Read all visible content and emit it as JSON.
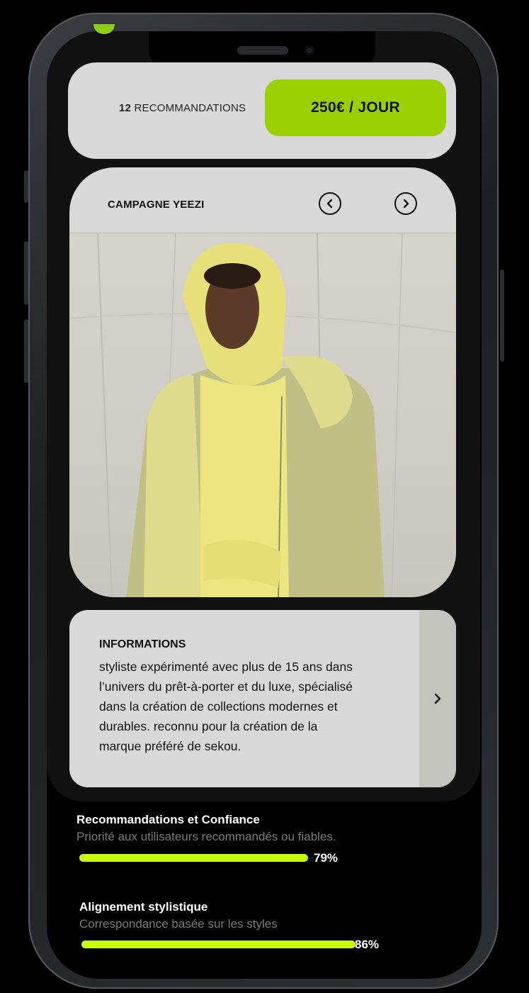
{
  "recommendations": {
    "count": "12",
    "label": "RECOMMANDATIONS",
    "price": "250€ / JOUR"
  },
  "campaign": {
    "title": "CAMPAGNE YEEZI",
    "prev_icon": "chevron-left-icon",
    "next_icon": "chevron-right-icon"
  },
  "informations": {
    "title": "INFORMATIONS",
    "lines": [
      "styliste expérimenté avec plus de 15 ans dans",
      "l’univers du prêt-à-porter et du luxe, spécialisé",
      "dans la création de collections modernes et",
      "durables. reconnu pour la création de la",
      "marque préféré de sekou."
    ],
    "expand_icon": "chevron-right-icon"
  },
  "metrics": [
    {
      "title": "Recommandations et Confiance",
      "subtitle": "Priorité aux utilisateurs recommandés ou fiables.",
      "percent": "79%",
      "value": 0.79
    },
    {
      "title": "Alignement stylistique",
      "subtitle": "Correspondance basée sur les styles",
      "percent": "86%",
      "value": 0.86
    }
  ],
  "colors": {
    "accent": "#9bd000",
    "progress": "#c7fb0a",
    "card": "#d9d9d9"
  }
}
